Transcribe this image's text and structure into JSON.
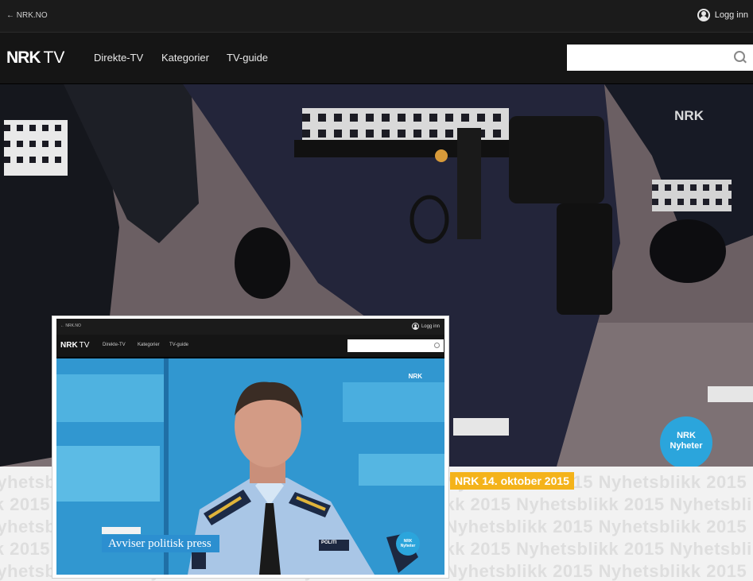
{
  "watermark": {
    "text_a": "Nyhetsblikk 2015 Nyhetsblikk 2015 Nyhetsblikk 2015 Nyhetsblikk 2015 Nyhetsblikk 2015",
    "text_b": "kk 2015 Nyhetsblikk 2015 Nyhetsblikk 2015 Nyhetsblikk 2015 Nyhetsblikk 2015 Nyhetsblikk"
  },
  "main_screen": {
    "topbar": {
      "back_link": "← NRK.NO",
      "login": "Logg inn"
    },
    "logo": {
      "mark": "NRK",
      "suffix": "TV"
    },
    "nav": [
      "Direkte-TV",
      "Kategorier",
      "TV-guide"
    ],
    "search": {
      "placeholder": ""
    },
    "video": {
      "channel_bug": "NRK",
      "badge_line1": "NRK",
      "badge_line2": "Nyheter"
    }
  },
  "date_label": "NRK 14. oktober 2015",
  "inset_screen": {
    "topbar": {
      "back_link": "← NRK.NO",
      "login": "Logg inn"
    },
    "logo": {
      "mark": "NRK",
      "suffix": "TV"
    },
    "nav": [
      "Direkte-TV",
      "Kategorier",
      "TV-guide"
    ],
    "video": {
      "channel_bug": "NRK",
      "caption": "Avviser politisk press",
      "badge_line1": "NRK",
      "badge_line2": "Nyheter",
      "shoulder_patch": "POLITI"
    }
  },
  "colors": {
    "accent_orange": "#f4b31a",
    "nrk_blue": "#2ba5dc",
    "nav_bg": "#151515",
    "topbar_bg": "#1b1b1b"
  },
  "icons": [
    "user-icon",
    "search-icon"
  ]
}
